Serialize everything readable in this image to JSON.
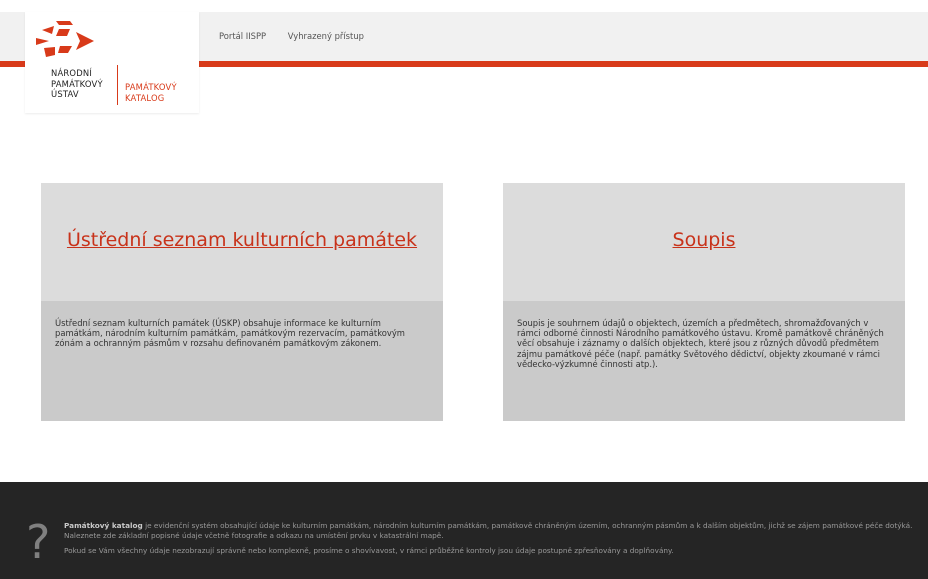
{
  "header": {
    "logo": {
      "org_lines": [
        "NÁRODNÍ",
        "PAMÁTKOVÝ",
        "ÚSTAV"
      ],
      "app_lines": [
        "PAMÁTKOVÝ",
        "KATALOG"
      ],
      "icon": "npu-logo-icon",
      "accent_color": "#d83a1a"
    },
    "nav": [
      "Portál IISPP",
      "Vyhrazený přístup"
    ]
  },
  "cards": [
    {
      "title": "Ústřední seznam kulturních památek",
      "description": "Ústřední seznam kulturních památek (ÚSKP) obsahuje informace ke kulturním památkám, národním kulturním památkám, památkovým rezervacím, památkovým zónám a ochranným pásmům v rozsahu definovaném památkovým zákonem."
    },
    {
      "title": "Soupis",
      "description": "Soupis je souhrnem údajů o objektech, územích a předmětech, shromažďovaných v rámci odborné činnosti Národního památkového ústavu. Kromě památkově chráněných věcí obsahuje i záznamy o dalších objektech, které jsou z různých důvodů předmětem zájmu památkové péče (např. památky Světového dědictví, objekty zkoumané v rámci vědecko-výzkumné činnosti atp.)."
    }
  ],
  "footer": {
    "icon": "question-mark-icon",
    "lead": "Památkový katalog",
    "text": " je evidenční systém obsahující údaje ke kulturním památkám, národním kulturním památkám, památkově chráněným územím, ochranným pásmům a k dalším objektům, jichž se zájem památkové péče dotýká. Naleznete zde základní popisné údaje včetně fotografie a odkazu na umístění prvku v katastrální mapě.",
    "note": "Pokud se Vám všechny údaje nezobrazují správně nebo komplexně, prosíme o shovívavost, v rámci průběžné kontroly jsou údaje postupně zpřesňovány a doplňovány."
  }
}
